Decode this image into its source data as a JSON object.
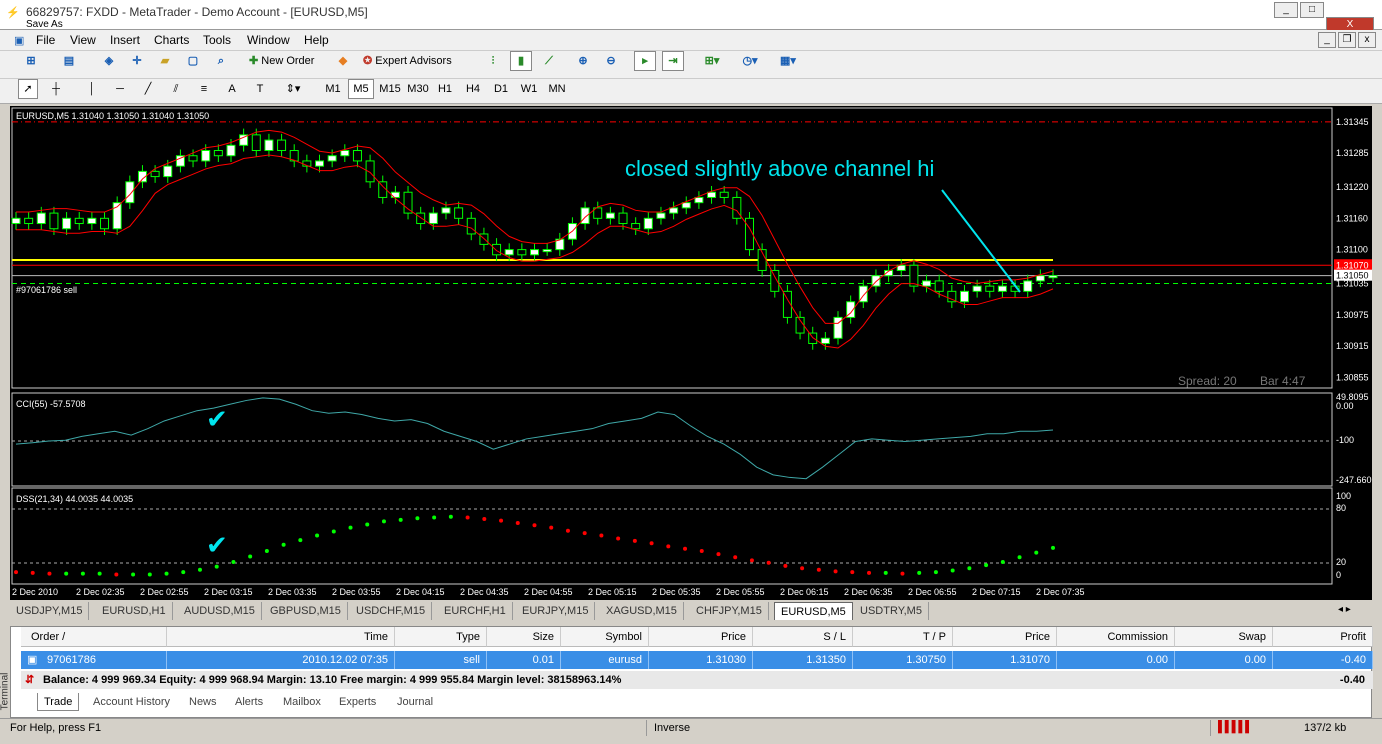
{
  "window": {
    "title": "66829757: FXDD - MetaTrader - Demo Account - [EURUSD,M5]",
    "save_as": "Save As",
    "min": "_",
    "max": "□",
    "close": "X"
  },
  "menu": [
    "File",
    "View",
    "Insert",
    "Charts",
    "Tools",
    "Window",
    "Help"
  ],
  "toolbar": {
    "new_order": "New Order",
    "expert_advisors": "Expert Advisors"
  },
  "timeframes": [
    "M1",
    "M5",
    "M15",
    "M30",
    "H1",
    "H4",
    "D1",
    "W1",
    "MN"
  ],
  "active_timeframe": "M5",
  "chart": {
    "header": "EURUSD,M5  1.31040 1.31050 1.31040 1.31050",
    "annotation": "closed slightly above channel hi",
    "order_label": "#97061786 sell",
    "spread": "Spread: 20",
    "bar": "Bar  4:47",
    "price_labels": [
      "1.31345",
      "1.31285",
      "1.31220",
      "1.31160",
      "1.31100",
      "1.31070",
      "1.31050",
      "1.31035",
      "1.30975",
      "1.30915",
      "1.30855"
    ],
    "price_level_marks": [
      1.31345,
      1.31285,
      1.3122,
      1.3116,
      1.311,
      1.3107,
      1.3105,
      1.31035,
      1.30975,
      1.30915,
      1.30855
    ],
    "price_range": [
      1.3085,
      1.3136
    ],
    "time_labels": [
      "2 Dec 2010",
      "2 Dec 02:35",
      "2 Dec 02:55",
      "2 Dec 03:15",
      "2 Dec 03:35",
      "2 Dec 03:55",
      "2 Dec 04:15",
      "2 Dec 04:35",
      "2 Dec 04:55",
      "2 Dec 05:15",
      "2 Dec 05:35",
      "2 Dec 05:55",
      "2 Dec 06:15",
      "2 Dec 06:35",
      "2 Dec 06:55",
      "2 Dec 07:15",
      "2 Dec 07:35"
    ],
    "cci_header": "CCI(55) -57.5708",
    "cci_labels": [
      "49.8095",
      "0.00",
      "-100",
      "-247.660"
    ],
    "dss_header": "DSS(21,34) 44.0035 44.0035",
    "dss_labels": [
      "100",
      "80",
      "20",
      "0"
    ],
    "colors": {
      "bull": "#ffffff",
      "bear": "#000000",
      "wick": "#00ff00",
      "channel": "#ff0000",
      "channel_hi": "#ffff00",
      "annotation": "#00e5ee",
      "cci": "#3fa8a8",
      "dss_up": "#00ff00",
      "dss_down": "#ff0000"
    }
  },
  "chart_data": {
    "type": "line",
    "title": "EURUSD,M5",
    "price_closes": [
      1.3116,
      1.3115,
      1.3117,
      1.3114,
      1.3116,
      1.3115,
      1.3116,
      1.3114,
      1.3119,
      1.3123,
      1.3125,
      1.3124,
      1.3126,
      1.3128,
      1.3127,
      1.3129,
      1.3128,
      1.313,
      1.3132,
      1.3129,
      1.3131,
      1.3129,
      1.3127,
      1.3126,
      1.3127,
      1.3128,
      1.3129,
      1.3127,
      1.3123,
      1.312,
      1.3121,
      1.3117,
      1.3115,
      1.3117,
      1.3118,
      1.3116,
      1.3113,
      1.3111,
      1.3109,
      1.311,
      1.3109,
      1.311,
      1.311,
      1.3112,
      1.3115,
      1.3118,
      1.3116,
      1.3117,
      1.3115,
      1.3114,
      1.3116,
      1.3117,
      1.3118,
      1.3119,
      1.312,
      1.3121,
      1.312,
      1.3116,
      1.311,
      1.3106,
      1.3102,
      1.3097,
      1.3094,
      1.3092,
      1.3093,
      1.3097,
      1.31,
      1.3103,
      1.3105,
      1.3106,
      1.3107,
      1.3103,
      1.3104,
      1.3102,
      1.31,
      1.3102,
      1.3103,
      1.3102,
      1.3103,
      1.3102,
      1.3104,
      1.3105,
      1.3105
    ],
    "cci_values": [
      -110,
      -105,
      -98,
      -95,
      -80,
      -70,
      -60,
      -75,
      -50,
      -20,
      0,
      20,
      30,
      45,
      60,
      70,
      65,
      45,
      20,
      10,
      15,
      5,
      -10,
      -20,
      -15,
      -30,
      -60,
      -80,
      -100,
      -130,
      -110,
      -90,
      -80,
      -70,
      -60,
      -50,
      -30,
      -20,
      -10,
      15,
      5,
      -40,
      -80,
      -110,
      -150,
      -200,
      -230,
      -240,
      -245,
      -200,
      -150,
      -100,
      -90,
      -95,
      -100,
      -95,
      -90,
      -85,
      -80,
      -70,
      -70,
      -60,
      -60,
      -55
    ],
    "dss_values": [
      5,
      4,
      3,
      3,
      3,
      3,
      2,
      2,
      2,
      3,
      5,
      8,
      12,
      18,
      25,
      32,
      40,
      46,
      52,
      57,
      62,
      66,
      70,
      72,
      74,
      75,
      76,
      75,
      73,
      71,
      68,
      65,
      62,
      58,
      55,
      52,
      48,
      45,
      42,
      38,
      35,
      32,
      28,
      24,
      20,
      17,
      13,
      10,
      8,
      6,
      5,
      4,
      4,
      3,
      4,
      5,
      7,
      10,
      14,
      18,
      24,
      30,
      36
    ],
    "ylim": [
      1.3085,
      1.3136
    ]
  },
  "symbol_tabs": [
    "USDJPY,M15",
    "EURUSD,H1",
    "AUDUSD,M15",
    "GBPUSD,M15",
    "USDCHF,M15",
    "EURCHF,H1",
    "EURJPY,M15",
    "XAGUSD,M15",
    "CHFJPY,M15",
    "EURUSD,M5",
    "USDTRY,M5"
  ],
  "active_symbol_tab": "EURUSD,M5",
  "terminal": {
    "side_label": "Terminal",
    "columns": [
      "Order",
      "Time",
      "Type",
      "Size",
      "Symbol",
      "Price",
      "S / L",
      "T / P",
      "Price",
      "Commission",
      "Swap",
      "Profit"
    ],
    "sort_mark": "/",
    "rows": [
      {
        "order": "97061786",
        "time": "2010.12.02 07:35",
        "type": "sell",
        "size": "0.01",
        "symbol": "eurusd",
        "price": "1.31030",
        "sl": "1.31350",
        "tp": "1.30750",
        "cur_price": "1.31070",
        "commission": "0.00",
        "swap": "0.00",
        "profit": "-0.40"
      }
    ],
    "balance_line": "Balance: 4 999 969.34  Equity: 4 999 968.94  Margin: 13.10  Free margin: 4 999 955.84  Margin level: 38158963.14%",
    "balance_profit": "-0.40",
    "tabs": [
      "Trade",
      "Account History",
      "News",
      "Alerts",
      "Mailbox",
      "Experts",
      "Journal"
    ],
    "active_tab": "Trade"
  },
  "status": {
    "help": "For Help, press F1",
    "profile": "Inverse",
    "traffic": "137/2 kb"
  }
}
